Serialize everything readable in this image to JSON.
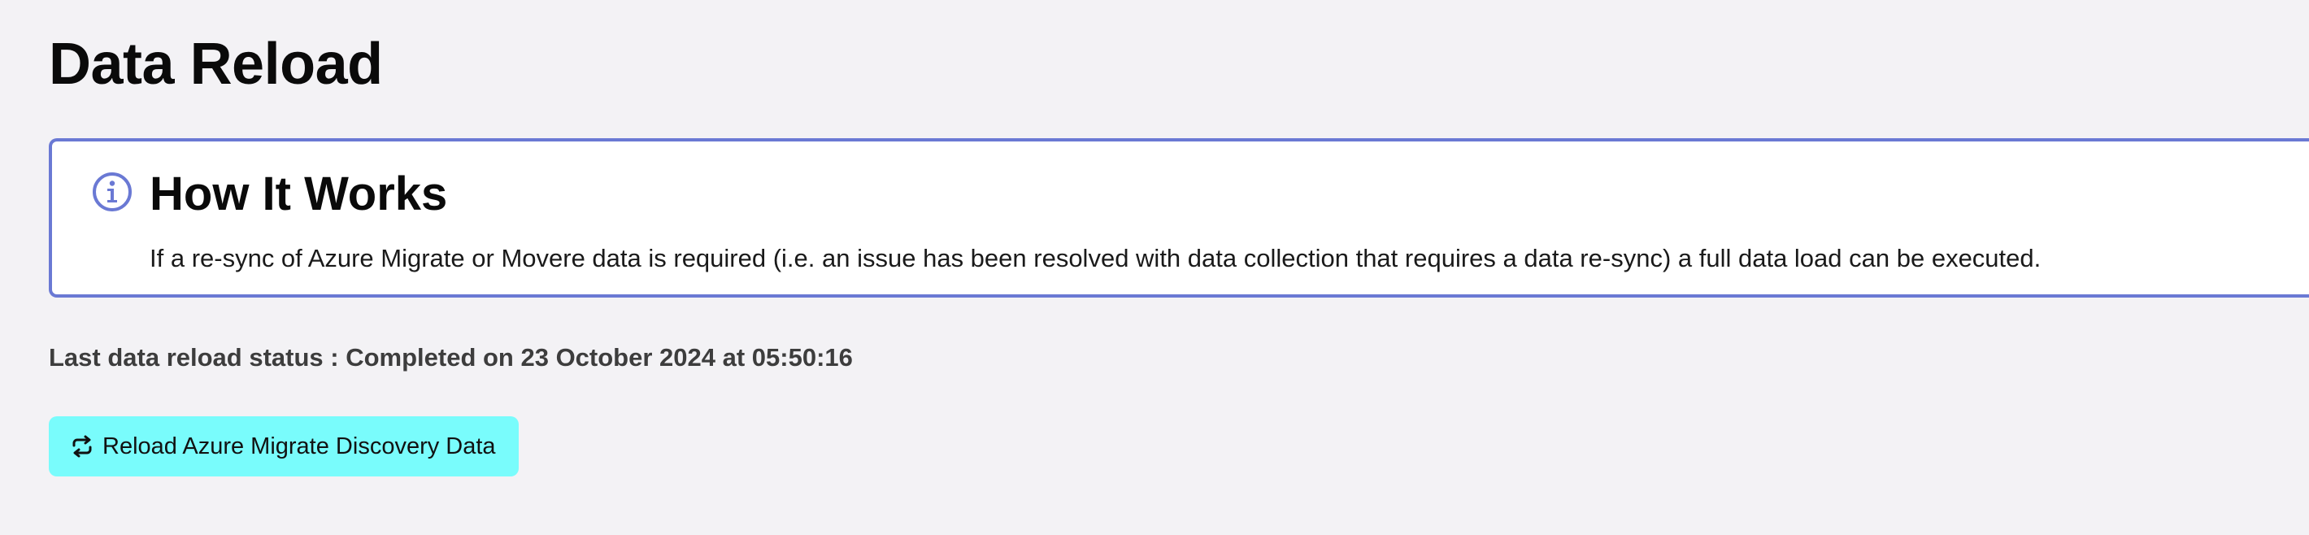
{
  "page": {
    "title": "Data Reload"
  },
  "info": {
    "icon": "info-circle-icon",
    "heading": "How It Works",
    "body": "If a re-sync of Azure Migrate or Movere data is required (i.e. an issue has been resolved with data collection that requires a data re-sync) a full data load can be executed.",
    "accent_color": "#6a79d4"
  },
  "status": {
    "text": "Last data reload status : Completed on 23 October 2024 at 05:50:16"
  },
  "actions": {
    "reload_label": "Reload Azure Migrate Discovery Data",
    "reload_icon": "refresh-icon",
    "button_color": "#79fcfc"
  }
}
